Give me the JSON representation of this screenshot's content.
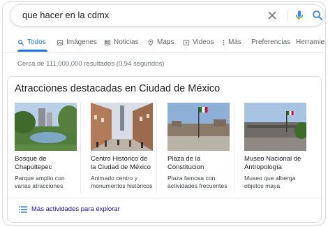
{
  "search": {
    "query": "que hacer en la cdmx"
  },
  "tabs": [
    {
      "label": "Todos",
      "icon": "search-icon",
      "active": true
    },
    {
      "label": "Imágenes",
      "icon": "image-icon"
    },
    {
      "label": "Noticias",
      "icon": "newspaper-icon"
    },
    {
      "label": "Maps",
      "icon": "map-pin-icon"
    },
    {
      "label": "Videos",
      "icon": "play-icon"
    },
    {
      "label": "Más",
      "icon": "more-vert-icon"
    },
    {
      "label": "Preferencias"
    },
    {
      "label": "Herramientas"
    }
  ],
  "results": {
    "stats": "Cerca de 111,000,000 resultados (0.94 segundos)"
  },
  "attractions": {
    "title": "Atracciones destacadas en Ciudad de México",
    "items": [
      {
        "name": "Bosque de Chapultepec",
        "desc": "Parque amplio con varias atracciones"
      },
      {
        "name": "Centro Histórico de la Ciudad de México",
        "desc": "Animado centro y monumentos históricos"
      },
      {
        "name": "Plaza de la Constitucion",
        "desc": "Plaza famosa con actividades frecuentes"
      },
      {
        "name": "Museo Nacional de Antropología",
        "desc": "Museo que alberga objetos maya"
      }
    ],
    "more_label": "Más actividades para explorar"
  },
  "colors": {
    "accent": "#1a73e8",
    "link": "#1a0dab",
    "border": "#dadce0"
  }
}
